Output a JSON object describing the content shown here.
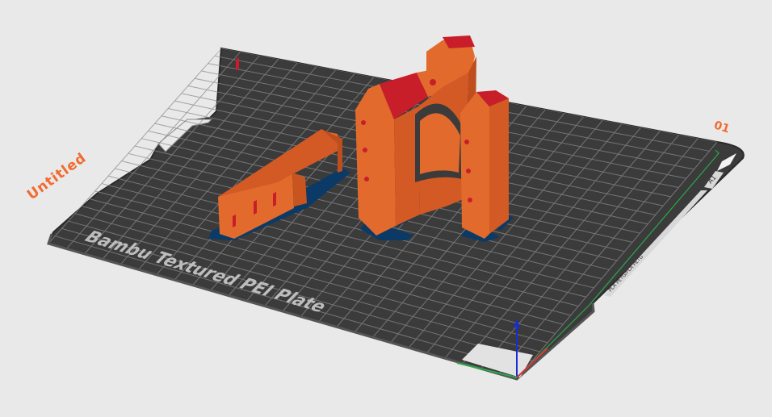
{
  "plate": {
    "name": "Untitled",
    "number": "01",
    "type_label": "Bambu Textured PEI Plate",
    "side_label": "PLA PETG/PLA PETG",
    "corner_label": "A1"
  },
  "colors": {
    "background": "#e9e9e9",
    "bed": "#3b3b3b",
    "model_orange": "#e26a2c",
    "model_red": "#c81e2a",
    "brim_blue": "#0b3a66",
    "accent_label": "#f26a30",
    "axis_x": "#d63333",
    "axis_y": "#2aa84a",
    "axis_z": "#1a2bd6"
  },
  "icons": {
    "axes": "xyz-axes-gizmo",
    "handle": "bed-handle"
  }
}
